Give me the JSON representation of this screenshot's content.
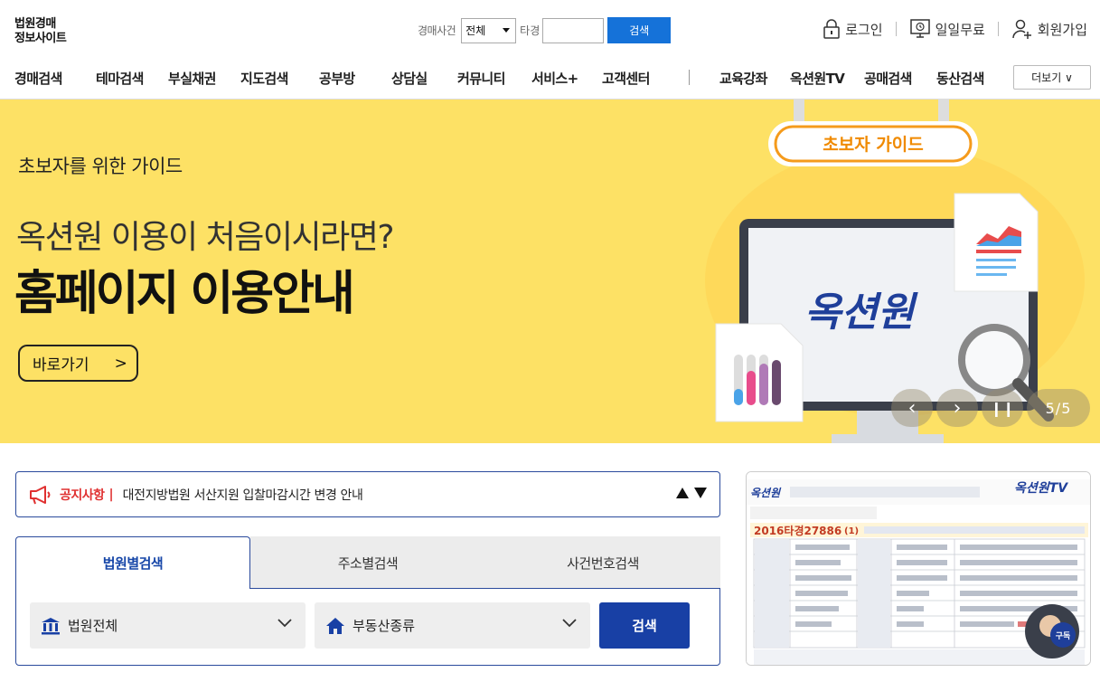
{
  "header": {
    "logo_line1": "법원경매",
    "logo_line2": "정보사이트",
    "search": {
      "label": "경매사건",
      "select_value": "전체",
      "label2": "타경",
      "input_value": "",
      "button": "검색"
    },
    "user_links": {
      "login": "로그인",
      "trial": "일일무료",
      "signup": "회원가입"
    }
  },
  "nav": {
    "items": [
      "경매검색",
      "테마검색",
      "부실채권",
      "지도검색",
      "공부방",
      "상담실",
      "커뮤니티",
      "서비스+",
      "고객센터",
      "교육강좌",
      "옥션원TV",
      "공매검색",
      "동산검색"
    ],
    "more": "더보기 ∨"
  },
  "banner": {
    "subtitle": "초보자를 위한 가이드",
    "line1": "옥션원 이용이 처음이시라면?",
    "line2": "홈페이지 이용안내",
    "cta": "바로가기",
    "cta_arrow": ">",
    "badge": "초보자 가이드",
    "screen_text": "옥션원",
    "slide_counter": "5/5",
    "colors": {
      "background": "#fde165",
      "badge_border": "#f59b1c"
    }
  },
  "notice": {
    "title": "공지사항",
    "bar": "|",
    "text": "대전지방법원 서산지원 입찰마감시간 변경 안내"
  },
  "search_tabs": {
    "tabs": [
      "법원별검색",
      "주소별검색",
      "사건번호검색"
    ],
    "court_dropdown": "법원전체",
    "type_dropdown": "부동산종류",
    "button": "검색"
  },
  "tv": {
    "logo": "옥션원",
    "tv_logo": "옥션원TV",
    "case_title": "2016타경27886",
    "case_sub": "(1)",
    "avatar_label": "구독"
  }
}
